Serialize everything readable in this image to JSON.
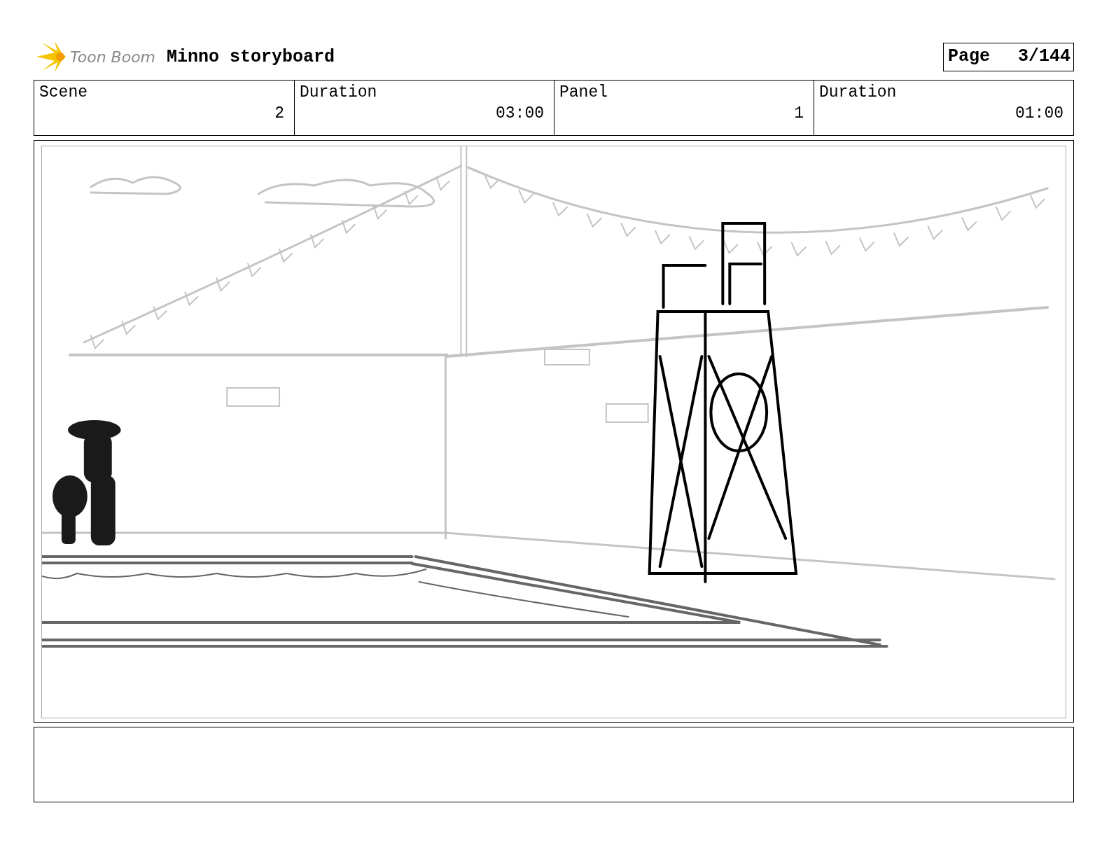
{
  "header": {
    "logo_text": "Toon Boom",
    "title": "Minno storyboard",
    "page_label": "Page",
    "page_value": "3/144"
  },
  "fields": [
    {
      "label": "Scene",
      "value": "2"
    },
    {
      "label": "Duration",
      "value": "03:00"
    },
    {
      "label": "Panel",
      "value": "1"
    },
    {
      "label": "Duration",
      "value": "01:00"
    }
  ]
}
